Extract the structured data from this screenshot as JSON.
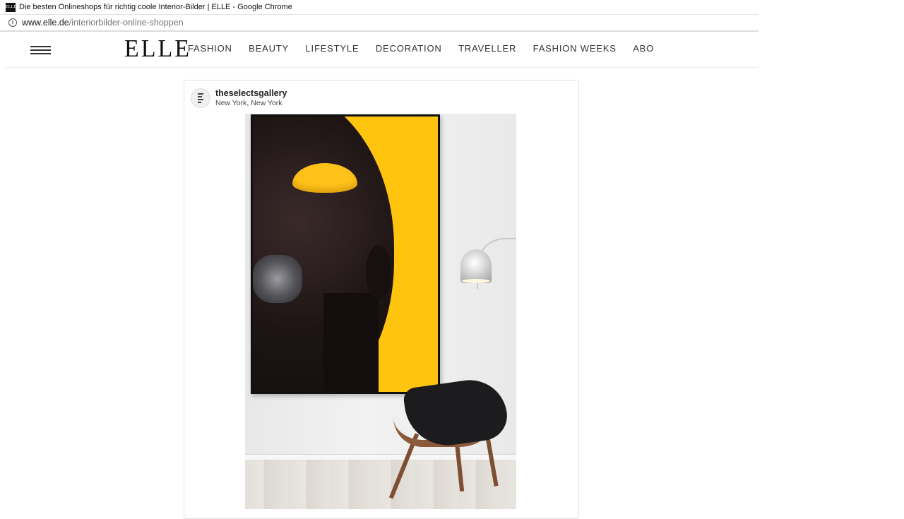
{
  "browser": {
    "favicon_text": "ELLE",
    "window_title": "Die besten Onlineshops für richtig coole Interior-Bilder | ELLE - Google Chrome",
    "url_host": "www.elle.de",
    "url_path": "/interiorbilder-online-shoppen"
  },
  "site": {
    "logo": "ELLE",
    "nav": [
      "FASHION",
      "BEAUTY",
      "LIFESTYLE",
      "DECORATION",
      "TRAVELLER",
      "FASHION WEEKS",
      "ABO"
    ]
  },
  "post": {
    "username": "theselectsgallery",
    "location": "New York, New York"
  },
  "colors": {
    "accent_yellow": "#ffc40d",
    "frame_black": "#111111"
  }
}
